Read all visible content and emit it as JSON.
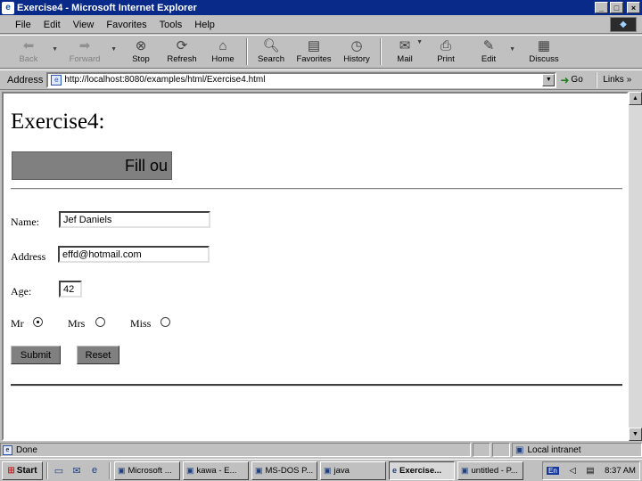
{
  "window": {
    "title": "Exercise4 - Microsoft Internet Explorer",
    "controls": {
      "minimize": "_",
      "maximize": "□",
      "close": "×"
    }
  },
  "menu": [
    "File",
    "Edit",
    "View",
    "Favorites",
    "Tools",
    "Help"
  ],
  "toolbar": {
    "back": "Back",
    "forward": "Forward",
    "stop": "Stop",
    "refresh": "Refresh",
    "home": "Home",
    "search": "Search",
    "favorites": "Favorites",
    "history": "History",
    "mail": "Mail",
    "print": "Print",
    "edit": "Edit",
    "discuss": "Discuss"
  },
  "address": {
    "label": "Address",
    "url": "http://localhost:8080/examples/html/Exercise4.html",
    "go": "Go",
    "links": "Links"
  },
  "page": {
    "heading": "Exercise4:",
    "marquee_text": "Fill ou",
    "name_label": "Name:",
    "name_value": "Jef Daniels",
    "address_label": "Address",
    "address_value": "effd@hotmail.com",
    "age_label": "Age:",
    "age_value": "42",
    "titles": [
      {
        "label": "Mr",
        "checked": true
      },
      {
        "label": "Mrs",
        "checked": false
      },
      {
        "label": "Miss",
        "checked": false
      }
    ],
    "submit": "Submit",
    "reset": "Reset"
  },
  "status": {
    "text": "Done",
    "zone": "Local intranet"
  },
  "taskbar": {
    "start": "Start",
    "tasks": [
      {
        "label": "Microsoft ...",
        "active": false
      },
      {
        "label": "kawa - E...",
        "active": false
      },
      {
        "label": "MS-DOS P...",
        "active": false
      },
      {
        "label": "java",
        "active": false
      },
      {
        "label": "Exercise...",
        "active": true
      },
      {
        "label": "untitled - P...",
        "active": false
      }
    ],
    "lang": "En",
    "clock": "8:37 AM"
  }
}
